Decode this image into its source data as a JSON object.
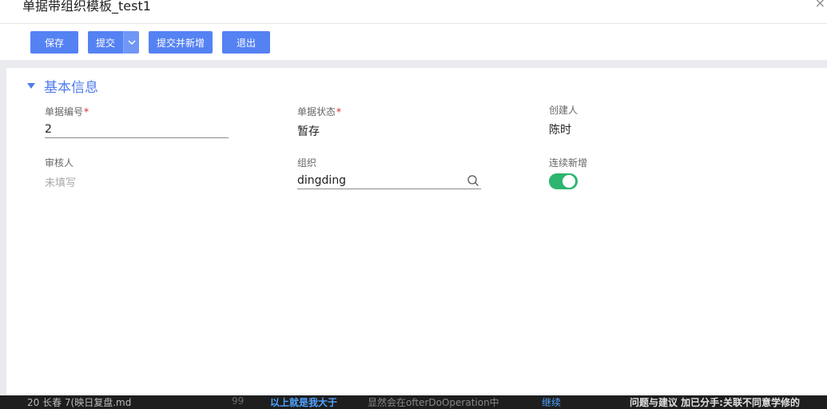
{
  "background_strip": {
    "a": "20 长春   7(映日复盘.md",
    "b": "99",
    "c": "以上就是我大于",
    "d": "显然会在ofterDoOperation中",
    "e": "继续",
    "f": "问题与建议   加已分手:关联不同意学修的"
  },
  "window": {
    "title": "单据带组织模板_test1",
    "close_glyph": "×"
  },
  "toolbar": {
    "save_label": "保存",
    "submit_label": "提交",
    "submit_new_label": "提交并新增",
    "exit_label": "退出"
  },
  "section": {
    "title": "基本信息"
  },
  "fields": {
    "bill_no": {
      "label": "单据编号",
      "required_mark": "*",
      "value": "2"
    },
    "bill_status": {
      "label": "单据状态",
      "required_mark": "*",
      "value": "暂存"
    },
    "creator": {
      "label": "创建人",
      "value": "陈时"
    },
    "auditor": {
      "label": "审核人",
      "placeholder": "未填写"
    },
    "org": {
      "label": "组织",
      "value": "dingding"
    },
    "continuous_add": {
      "label": "连续新增",
      "on": true
    }
  },
  "colors": {
    "primary": "#5582f3",
    "section_title": "#4e7bef",
    "toggle_on": "#2db56f",
    "required": "#e02020"
  },
  "icons": {
    "close": "close-icon",
    "dropdown": "chevron-down-icon",
    "collapse": "caret-down-icon",
    "search": "search-icon"
  }
}
